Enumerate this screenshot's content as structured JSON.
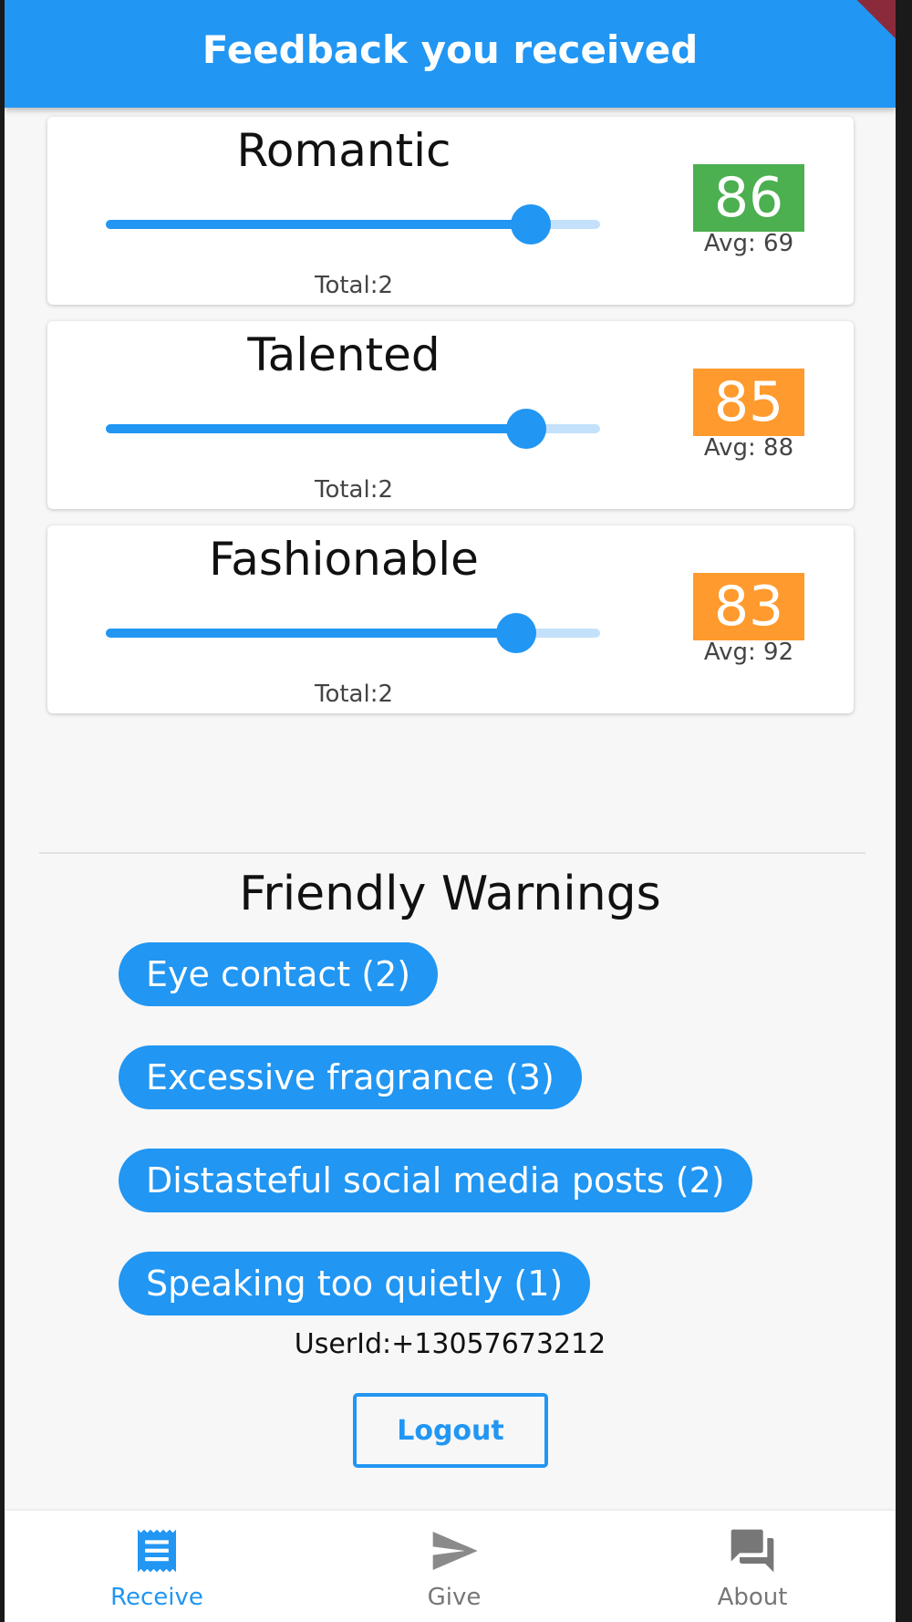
{
  "app_bar": {
    "title": "Feedback you received"
  },
  "ratings": [
    {
      "label": "Romantic",
      "value": 86,
      "average": "Avg: 69",
      "total": "Total:2",
      "badge_color": "#4caf50",
      "slider_fraction": 0.86
    },
    {
      "label": "Talented",
      "value": 85,
      "average": "Avg: 88",
      "total": "Total:2",
      "badge_color": "#ff9a2e",
      "slider_fraction": 0.85
    },
    {
      "label": "Fashionable",
      "value": 83,
      "average": "Avg: 92",
      "total": "Total:2",
      "badge_color": "#ff9a2e",
      "slider_fraction": 0.83
    }
  ],
  "warnings": {
    "title": "Friendly Warnings",
    "chips": [
      "Eye contact (2)",
      "Excessive fragrance (3)",
      "Distasteful social media posts (2)",
      "Speaking too quietly (1)"
    ]
  },
  "user_id": "UserId:+13057673212",
  "logout_label": "Logout",
  "bottom_nav": {
    "items": [
      {
        "label": "Receive",
        "icon": "receipt-icon",
        "active": true
      },
      {
        "label": "Give",
        "icon": "send-icon",
        "active": false
      },
      {
        "label": "About",
        "icon": "forum-icon",
        "active": false
      }
    ]
  },
  "colors": {
    "primary": "#2196f3",
    "good_badge": "#4caf50",
    "warn_badge": "#ff9a2e"
  }
}
